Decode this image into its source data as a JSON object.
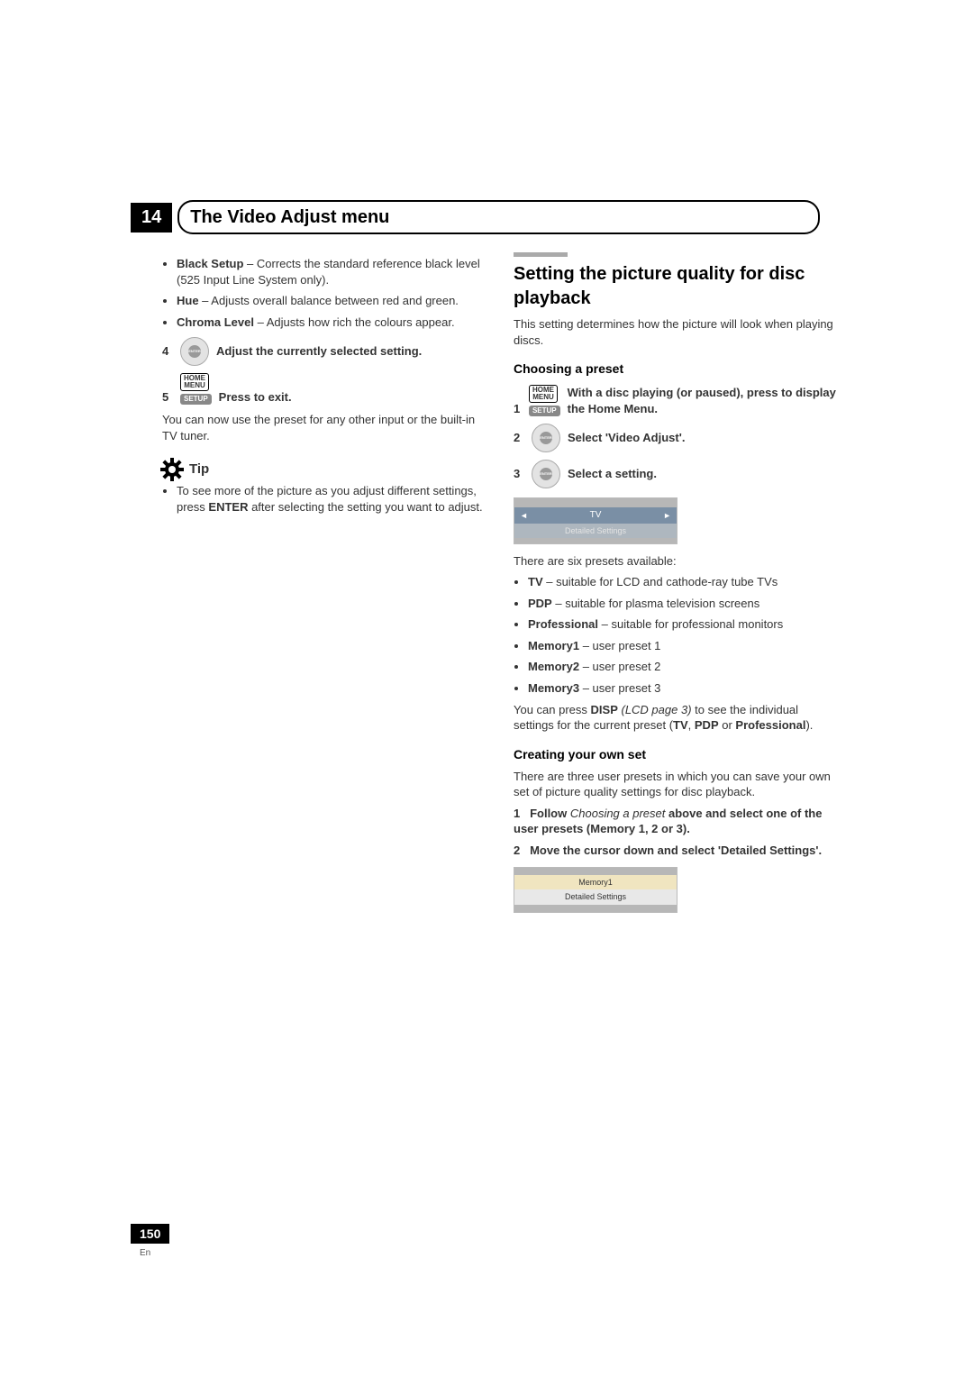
{
  "chapter": {
    "number": "14",
    "title": "The Video Adjust menu"
  },
  "left": {
    "bullets": [
      {
        "b": "Black Setup",
        "t": " – Corrects the standard reference black level (525 Input Line System only)."
      },
      {
        "b": "Hue",
        "t": " – Adjusts overall balance between red and green."
      },
      {
        "b": "Chroma Level",
        "t": " – Adjusts how rich the colours appear."
      }
    ],
    "step4": {
      "num": "4",
      "text": "Adjust the currently selected setting."
    },
    "step5": {
      "num": "5",
      "text": "Press to exit.",
      "home_menu": "HOME\nMENU",
      "setup": "SETUP"
    },
    "after5": "You can now use the preset for any other input or the built-in TV tuner.",
    "tip_label": "Tip",
    "tip_text_pre": "To see more of the picture as you adjust different settings, press ",
    "tip_enter": "ENTER",
    "tip_text_post": " after selecting the setting you want to adjust."
  },
  "right": {
    "h2": "Setting the picture quality for disc playback",
    "intro": "This setting determines how the picture will look when playing discs.",
    "choosing_h3": "Choosing a preset",
    "step1": {
      "num": "1",
      "home_menu": "HOME\nMENU",
      "setup": "SETUP",
      "text": "With a disc playing (or paused), press to display the Home Menu."
    },
    "step2": {
      "num": "2",
      "text": "Select 'Video Adjust'."
    },
    "step3": {
      "num": "3",
      "text": "Select a setting."
    },
    "ui1": {
      "active": "TV",
      "detail": "Detailed Settings"
    },
    "presets_intro": "There are six presets available:",
    "presets": [
      {
        "b": "TV",
        "t": " – suitable for LCD and cathode-ray tube TVs"
      },
      {
        "b": "PDP",
        "t": " – suitable for plasma television screens"
      },
      {
        "b": "Professional",
        "t": " – suitable for professional monitors"
      },
      {
        "b": "Memory1",
        "t": " – user preset 1"
      },
      {
        "b": "Memory2",
        "t": " – user preset 2"
      },
      {
        "b": "Memory3",
        "t": " – user preset 3"
      }
    ],
    "disp_line_pre": "You can press ",
    "disp_b": "DISP",
    "disp_i": " (LCD page 3)",
    "disp_mid": " to see the individual settings for the current preset (",
    "disp_tv": "TV",
    "disp_sep1": ", ",
    "disp_pdp": "PDP",
    "disp_sep2": " or ",
    "disp_pro": "Professional",
    "disp_end": ").",
    "creating_h3": "Creating your own set",
    "creating_intro": "There are three user presets in which you can save your own set of picture quality settings for disc playback.",
    "cstep1": {
      "num": "1",
      "b1": "Follow ",
      "i": "Choosing a preset",
      "b2": " above and select one of the user presets (Memory 1, 2 or 3)."
    },
    "cstep2": {
      "num": "2",
      "text": "Move the cursor down and select 'Detailed Settings'."
    },
    "ui2": {
      "row1": "Memory1",
      "row2": "Detailed Settings"
    }
  },
  "footer": {
    "page": "150",
    "lang": "En"
  }
}
